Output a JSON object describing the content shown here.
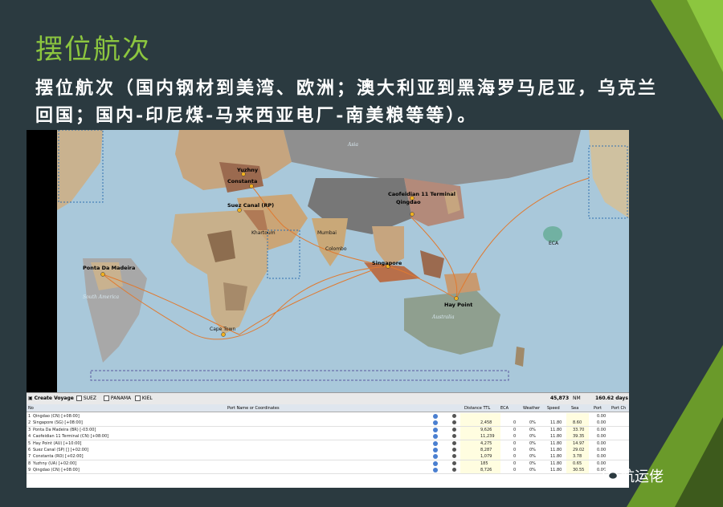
{
  "slide": {
    "title": "摆位航次",
    "subtitle": "摆位航次（国内钢材到美湾、欧洲；澳大利亚到黑海罗马尼亚，乌克兰回国；国内-印尼煤-马来西亚电厂-南美粮等等）。",
    "watermark": "航运佬"
  },
  "colors": {
    "title": "#8cc63f",
    "background": "#2b3a40",
    "accent_green": "#6a9a2a",
    "route": "#e07a30"
  },
  "map": {
    "ocean_labels": [
      "Asia",
      "Australia",
      "South America"
    ],
    "port_labels": [
      "Yuzhny",
      "Constanta",
      "Suez Canal (RP)",
      "Caofeidian 11 Terminal",
      "Qingdao",
      "Ponta Da Madeira",
      "Singapore",
      "Hay Point",
      "Cape Town",
      "Mumbai",
      "Colombo",
      "Khartoum"
    ],
    "eca_labels": [
      "ECA"
    ]
  },
  "toolbar": {
    "create_voyage": "Create Voyage",
    "suez": "SUEZ",
    "panama": "PANAMA",
    "kiel": "KIEL",
    "distance": "45,873",
    "distance_unit": "NM",
    "days": "160.62 days"
  },
  "grid": {
    "headers": [
      "No",
      "Port Name or Coordinates",
      "Distance TTL",
      "ECA",
      "Weather",
      "Speed",
      "Sea",
      "Port",
      "Port Ch"
    ],
    "rows": [
      {
        "no": "1",
        "port": "Qingdao (CN) [+08:00]",
        "distance": "",
        "eca": "",
        "weather": "",
        "speed": "",
        "sea": "",
        "port_days": "0.00"
      },
      {
        "no": "2",
        "port": "Singapore (SG) [+08:00]",
        "distance": "2,458",
        "eca": "0",
        "weather": "0%",
        "speed": "11.80",
        "sea": "8.60",
        "port_days": "0.00"
      },
      {
        "no": "3",
        "port": "Ponta Da Madeira (BR) [-03:00]",
        "distance": "9,626",
        "eca": "0",
        "weather": "0%",
        "speed": "11.80",
        "sea": "33.70",
        "port_days": "0.00"
      },
      {
        "no": "4",
        "port": "Caofeidian 11 Terminal (CN) [+08:00]",
        "distance": "11,239",
        "eca": "0",
        "weather": "0%",
        "speed": "11.80",
        "sea": "39.35",
        "port_days": "0.00"
      },
      {
        "no": "5",
        "port": "Hay Point (AU) [+10:00]",
        "distance": "4,275",
        "eca": "0",
        "weather": "0%",
        "speed": "11.80",
        "sea": "14.97",
        "port_days": "0.00"
      },
      {
        "no": "6",
        "port": "Suez Canal (SP) [] [+02:00]",
        "distance": "8,287",
        "eca": "0",
        "weather": "0%",
        "speed": "11.80",
        "sea": "29.02",
        "port_days": "0.00"
      },
      {
        "no": "7",
        "port": "Constanta (RO) [+02:00]",
        "distance": "1,079",
        "eca": "0",
        "weather": "0%",
        "speed": "11.80",
        "sea": "3.78",
        "port_days": "0.00"
      },
      {
        "no": "8",
        "port": "Yuzhny (UA) [+02:00]",
        "distance": "185",
        "eca": "0",
        "weather": "0%",
        "speed": "11.80",
        "sea": "0.65",
        "port_days": "0.00"
      },
      {
        "no": "9",
        "port": "Qingdao (CN) [+08:00]",
        "distance": "8,726",
        "eca": "0",
        "weather": "0%",
        "speed": "11.80",
        "sea": "30.55",
        "port_days": "0.00"
      }
    ]
  }
}
